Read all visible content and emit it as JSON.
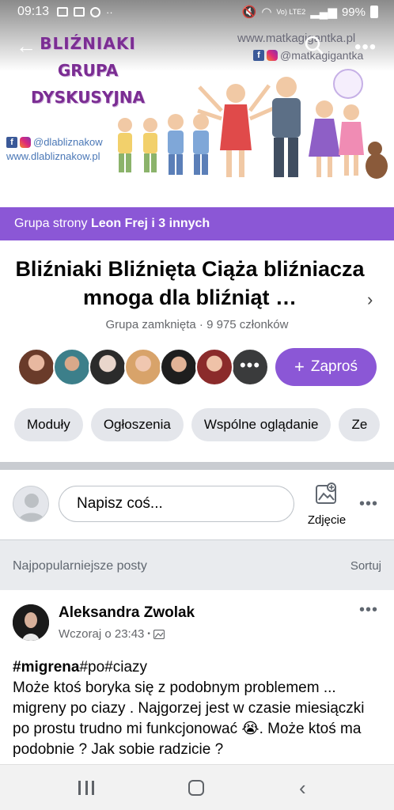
{
  "status_bar": {
    "time": "09:13",
    "network": "Vo) LTE2",
    "battery": "99%"
  },
  "cover": {
    "title_line1": "BLIŹNIAKI",
    "title_line2": "GRUPA",
    "title_line3": "DYSKUSYJNA",
    "url_right": "www.matkagigantka.pl",
    "handle_right": "@matkagigantka",
    "handle_left": "@dlabliznakow",
    "url_left": "www.dlabliznakow.pl"
  },
  "owner_band": {
    "prefix": "Grupa strony ",
    "owner": "Leon Frej i 3 innych"
  },
  "group": {
    "title": "Bliźniaki Bliźnięta Ciąża bliźniacza mnoga dla bliźniąt …",
    "meta": "Grupa zamknięta · 9 975 członków",
    "more_members": "•••",
    "invite_plus": "+",
    "invite_label": "Zaproś"
  },
  "tabs": [
    {
      "label": "Moduły"
    },
    {
      "label": "Ogłoszenia"
    },
    {
      "label": "Wspólne oglądanie"
    },
    {
      "label": "Ze"
    }
  ],
  "composer": {
    "placeholder": "Napisz coś...",
    "photo_label": "Zdjęcie"
  },
  "feed": {
    "title": "Najpopularniejsze posty",
    "sort_label": "Sortuj"
  },
  "post": {
    "author": "Aleksandra Zwolak",
    "timestamp": "Wczoraj o 23:43",
    "meta_sep": "•",
    "hashtag_strong": "#migrena",
    "hashtag_rest": "#po#ciazy",
    "body": "Może ktoś boryka się z podobnym problemem ... migreny po ciazy . Najgorzej jest w czasie miesiączki po prostu trudno mi funkcjonować 😭. Może ktoś ma podobnie ? Jak sobie radzicie ?"
  },
  "colors": {
    "accent": "#8b57d6",
    "pill_bg": "#e4e6eb",
    "feed_header_bg": "#e9ebee",
    "secondary_text": "#65676b"
  }
}
